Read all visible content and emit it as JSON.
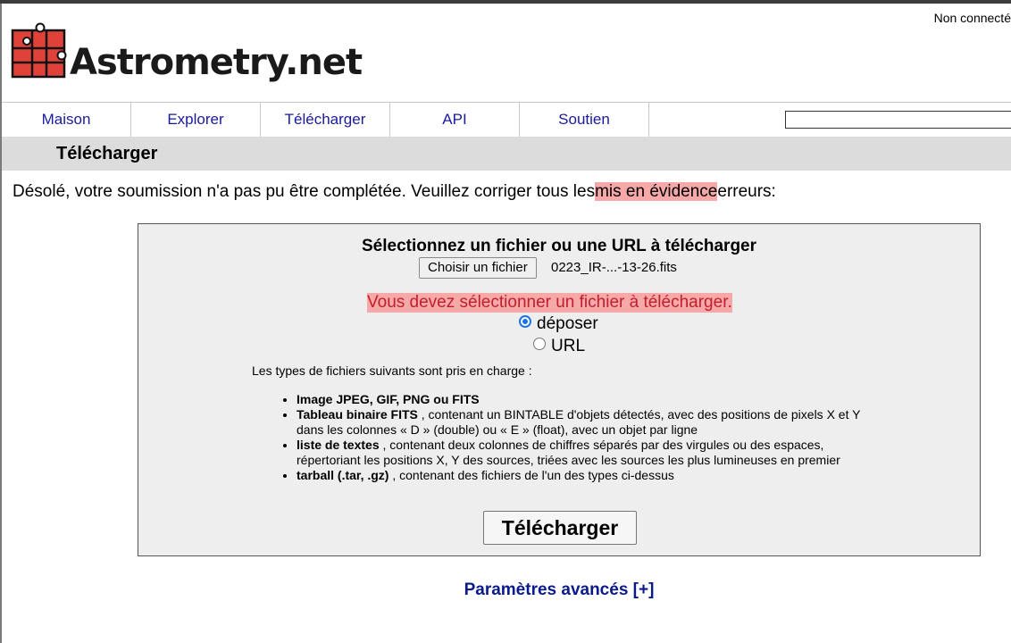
{
  "header": {
    "login_status": "Non connecté",
    "logo_text": "Astrometry.net",
    "search_value": ""
  },
  "nav": {
    "items": [
      "Maison",
      "Explorer",
      "Télécharger",
      "API",
      "Soutien"
    ]
  },
  "page": {
    "title": "Télécharger",
    "error_before": "Désolé, votre soumission n'a pas pu être complétée. Veuillez corriger tous les",
    "error_highlight": "mis en évidence",
    "error_after": "erreurs:"
  },
  "form": {
    "title": "Sélectionnez un fichier ou une URL à télécharger",
    "choose_button": "Choisir un fichier",
    "file_name": "0223_IR-...-13-26.fits",
    "file_error": "Vous devez sélectionner un fichier à télécharger.",
    "radio_upload": "déposer",
    "radio_url": "URL",
    "selected_option": "déposer",
    "types_intro": "Les types de fichiers suivants sont pris en charge :",
    "types": [
      {
        "name": "Image JPEG, GIF, PNG ou FITS",
        "desc": ""
      },
      {
        "name": "Tableau binaire FITS",
        "desc": " , contenant un BINTABLE d'objets détectés, avec des positions de pixels X et Y dans les colonnes « D » (double) ou « E » (float), avec un objet par ligne"
      },
      {
        "name": "liste de textes",
        "desc": " , contenant deux colonnes de chiffres séparés par des virgules ou des espaces, répertoriant les positions X, Y des sources, triées avec les sources les plus lumineuses en premier"
      },
      {
        "name": "tarball (.tar, .gz)",
        "desc": " , contenant des fichiers de l'un des types ci-dessus"
      }
    ],
    "submit_label": "Télécharger"
  },
  "advanced": {
    "label": "Paramètres avancés [+]"
  },
  "colors": {
    "link": "#1a1aa0",
    "error_highlight": "#f7a8a8",
    "error_text": "#c0202a",
    "panel_bg": "#eeeeee",
    "titlebar_bg": "#dcdcdc"
  }
}
